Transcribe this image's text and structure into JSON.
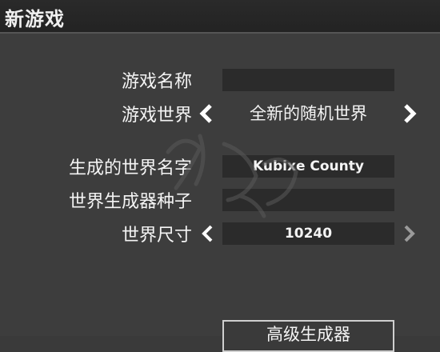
{
  "header": {
    "title": "新游戏"
  },
  "form": {
    "game_name": {
      "label": "游戏名称",
      "value": ""
    },
    "game_world": {
      "label": "游戏世界",
      "value": "全新的随机世界"
    },
    "generated_world_name": {
      "label": "生成的世界名字",
      "value": "Kubixe County"
    },
    "world_seed": {
      "label": "世界生成器种子",
      "value": ""
    },
    "world_size": {
      "label": "世界尺寸",
      "value": "10240"
    }
  },
  "advanced_button": {
    "label": "高级生成器"
  },
  "icons": {
    "left": "chevron-left-icon",
    "right": "chevron-right-icon"
  },
  "colors": {
    "background": "#3d3d3d",
    "field": "#2b2b2b",
    "text": "#f4f4f4"
  }
}
